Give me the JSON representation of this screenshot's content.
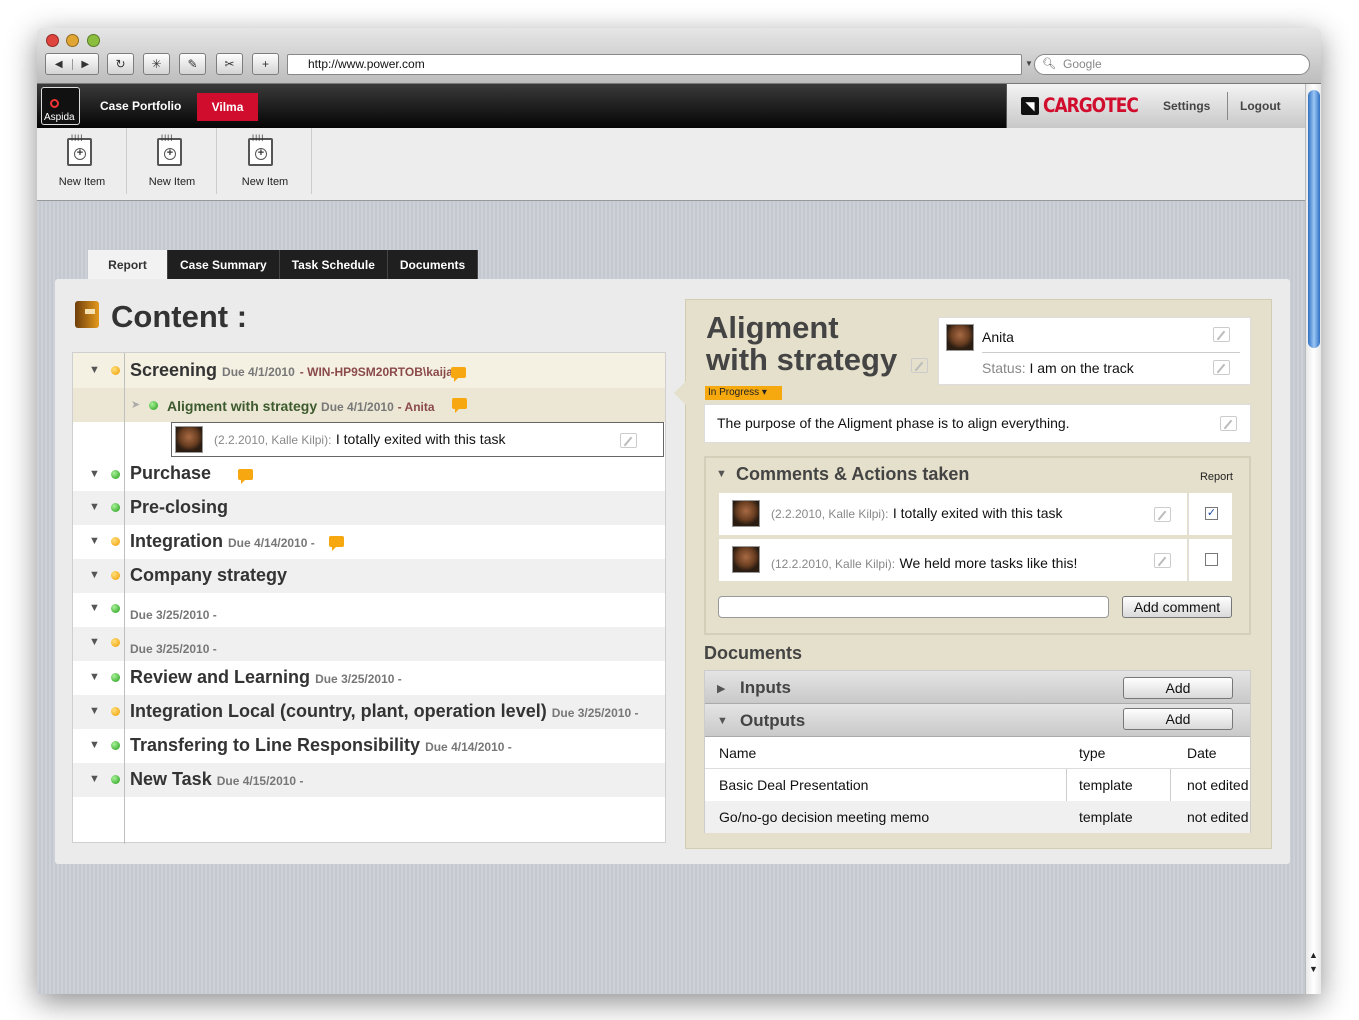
{
  "browser": {
    "url": "http://www.power.com",
    "search_placeholder": "Google",
    "buttons": [
      "◀",
      "▶",
      "↻",
      "✳",
      "✎",
      "✂",
      "+"
    ]
  },
  "app": {
    "logo_text": "Aspida",
    "nav_case_portfolio": "Case Portfolio",
    "nav_user": "Vilma",
    "brand": "CARGOTEC",
    "settings": "Settings",
    "logout": "Logout",
    "accent": "#d10d2e"
  },
  "toolbar": {
    "items": [
      {
        "label": "New Item"
      },
      {
        "label": "New Item"
      },
      {
        "label": "New Item"
      }
    ]
  },
  "tabs": [
    "Report",
    "Case Summary",
    "Task Schedule",
    "Documents"
  ],
  "content": {
    "title": "Content :",
    "tasks": [
      {
        "title": "Screening",
        "due": "Due 4/1/2010",
        "who": "WIN-HP9SM20RTOB\\kaija",
        "status": "orange"
      },
      {
        "title": "Purchase",
        "due": "",
        "who": "",
        "status": "green"
      },
      {
        "title": "Pre-closing",
        "due": "",
        "who": "",
        "status": "green"
      },
      {
        "title": "Integration",
        "due": "Due 4/14/2010 -",
        "who": "",
        "status": "orange"
      },
      {
        "title": "Company strategy",
        "due": "",
        "who": "",
        "status": "orange"
      },
      {
        "title": "",
        "due": "Due 3/25/2010 -",
        "who": "",
        "status": "green"
      },
      {
        "title": "",
        "due": "Due 3/25/2010 -",
        "who": "",
        "status": "orange"
      },
      {
        "title": "Review and Learning",
        "due": "Due 3/25/2010 -",
        "who": "",
        "status": "green"
      },
      {
        "title": "Integration Local (country, plant, operation level)",
        "due": "Due 3/25/2010 -",
        "who": "",
        "status": "orange"
      },
      {
        "title": "Transfering to Line Responsibility",
        "due": "Due 4/14/2010 -",
        "who": "",
        "status": "green"
      },
      {
        "title": "New Task",
        "due": "Due 4/15/2010 -",
        "who": "",
        "status": "green"
      }
    ],
    "subtask": {
      "title": "Aligment with strategy",
      "due": "Due 4/1/2010",
      "who": "Anita"
    },
    "comment": {
      "meta": "(2.2.2010, Kalle Kilpi):",
      "text": "I totally exited with this task"
    }
  },
  "detail": {
    "title_line1": "Aligment",
    "title_line2": "with strategy",
    "status_badge": "In Progress",
    "owner_name": "Anita",
    "status_label": "Status:",
    "status_value": "I am on the track",
    "description": "The purpose of the Aligment phase is to align everything.",
    "comments_title": "Comments & Actions taken",
    "report_label": "Report",
    "comments": [
      {
        "meta": "(2.2.2010, Kalle Kilpi):",
        "text": "I totally exited with this task",
        "checked": true
      },
      {
        "meta": "(12.2.2010, Kalle Kilpi):",
        "text": "We held more tasks like this!",
        "checked": false
      }
    ],
    "add_comment": "Add comment",
    "documents_title": "Documents",
    "inputs_label": "Inputs",
    "outputs_label": "Outputs",
    "add_label": "Add",
    "table_headers": [
      "Name",
      "type",
      "Date"
    ],
    "table_rows": [
      [
        "Basic Deal Presentation",
        "template",
        "not edited"
      ],
      [
        "Go/no-go decision meeting memo",
        "template",
        "not edited"
      ]
    ]
  }
}
